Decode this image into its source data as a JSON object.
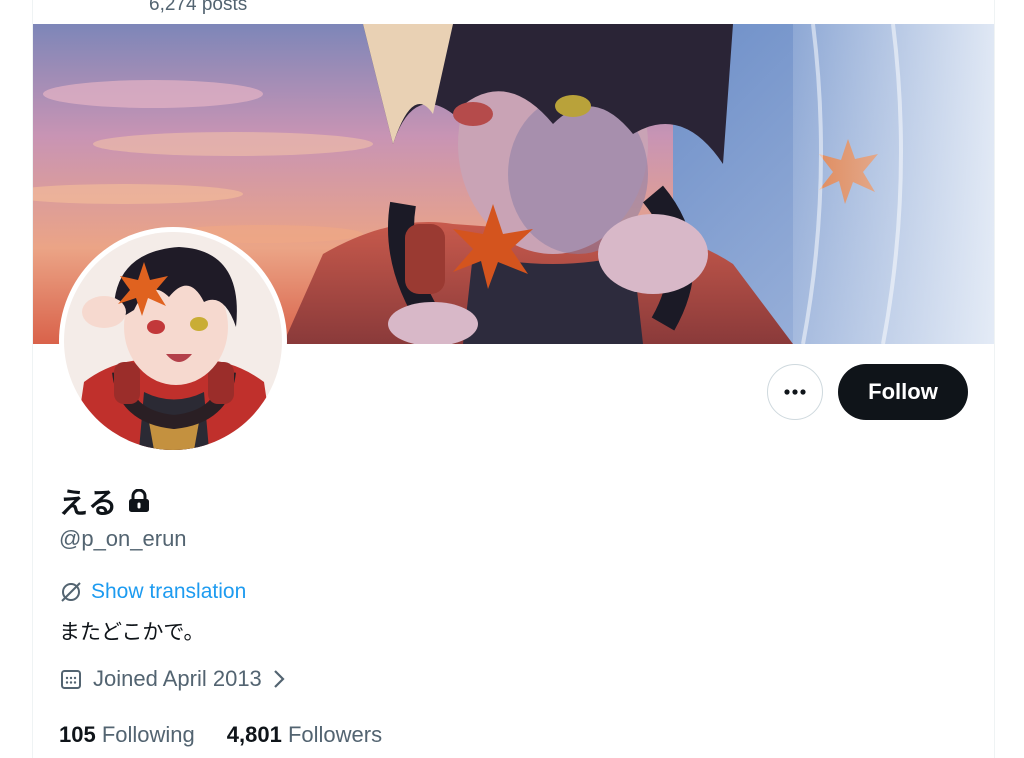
{
  "profile": {
    "post_count": "6,274 posts",
    "display_name": "える",
    "handle": "@p_on_erun",
    "bio": "またどこかで。",
    "joined": "Joined April 2013",
    "translation_label": "Show translation"
  },
  "actions": {
    "follow_label": "Follow",
    "more_icon": "more-horizontal-icon"
  },
  "stats": {
    "following_count": "105",
    "following_label": "Following",
    "followers_count": "4,801",
    "followers_label": "Followers"
  },
  "colors": {
    "accent": "#1d9bf0",
    "text_primary": "#0f1419",
    "text_secondary": "#536471",
    "follow_button_bg": "#0f1419"
  }
}
